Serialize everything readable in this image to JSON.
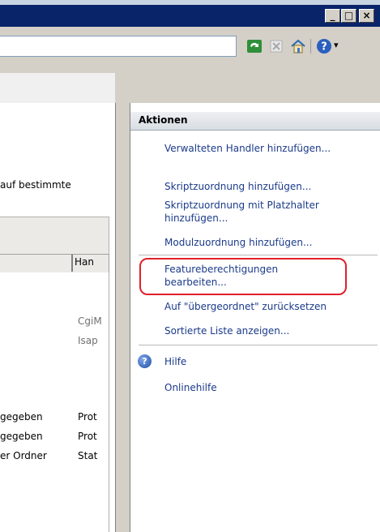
{
  "window": {
    "minimize_label": "_",
    "maximize_label": "□",
    "close_label": "×"
  },
  "toolbar": {
    "help_dropdown": "▾"
  },
  "content": {
    "description_fragment": "auf bestimmte",
    "column_handler_header": "Han",
    "rows": [
      {
        "col1": "",
        "col2": "CgiM"
      },
      {
        "col1": "",
        "col2": "Isap"
      },
      {
        "col1": "gegeben",
        "col2": "Prot"
      },
      {
        "col1": "gegeben",
        "col2": "Prot"
      },
      {
        "col1": "er Ordner",
        "col2": "Stat"
      }
    ]
  },
  "actions": {
    "title": "Aktionen",
    "items": [
      {
        "label": "Verwalteten Handler hinzufügen..."
      },
      {
        "label": "Skriptzuordnung hinzufügen..."
      },
      {
        "label": "Skriptzuordnung mit Platzhalter hinzufügen..."
      },
      {
        "label": "Modulzuordnung hinzufügen..."
      },
      {
        "label": "Featureberechtigungen bearbeiten..."
      },
      {
        "label": "Auf \"übergeordnet\" zurücksetzen"
      },
      {
        "label": "Sortierte Liste anzeigen..."
      }
    ],
    "help_label": "Hilfe",
    "online_help_label": "Onlinehilfe"
  },
  "colors": {
    "titlebar": "#0a246a",
    "link": "#1a3a8a",
    "highlight_box": "#e0202a"
  }
}
